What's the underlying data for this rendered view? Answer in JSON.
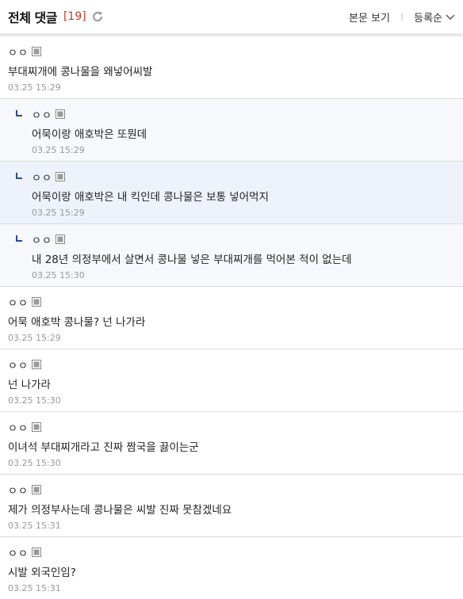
{
  "header": {
    "title": "전체 댓글",
    "count": "[19]",
    "view_body_label": "본문 보기",
    "separator": "ㅣ",
    "sort_label": "등록순"
  },
  "colors": {
    "count": "#c0392b",
    "reply_mark": "#2f4a8a",
    "reply_bg": "#f7f8fb",
    "highlight_bg": "#eef2fb"
  },
  "comments": [
    {
      "author": "ㅇㅇ",
      "text": "부대찌개에 콩나물을 왜넣어씨발",
      "date": "03.25 15:29",
      "reply": false
    },
    {
      "author": "ㅇㅇ",
      "text": "어묵이랑 애호박은 또뭔데",
      "date": "03.25 15:29",
      "reply": true
    },
    {
      "author": "ㅇㅇ",
      "text": "어묵이랑 애호박은 내 킥인데 콩나물은 보통 넣어먹지",
      "date": "03.25 15:29",
      "reply": true
    },
    {
      "author": "ㅇㅇ",
      "text": "내 28년 의정부에서 살면서 콩나물 넣은 부대찌개를 먹어본 적이 없는데",
      "date": "03.25 15:30",
      "reply": true
    },
    {
      "author": "ㅇㅇ",
      "text": "어묵 애호박 콩나물? 넌 나가라",
      "date": "03.25 15:29",
      "reply": false
    },
    {
      "author": "ㅇㅇ",
      "text": "넌 나가라",
      "date": "03.25 15:30",
      "reply": false
    },
    {
      "author": "ㅇㅇ",
      "text": "이녀석 부대찌개라고 진짜 짬국을 끓이는군",
      "date": "03.25 15:30",
      "reply": false
    },
    {
      "author": "ㅇㅇ",
      "text": "제가 의정부사는데 콩나물은 씨발 진짜 못참겠네요",
      "date": "03.25 15:31",
      "reply": false
    },
    {
      "author": "ㅇㅇ",
      "text": "시발 외국인임?",
      "date": "03.25 15:31",
      "reply": false
    }
  ]
}
